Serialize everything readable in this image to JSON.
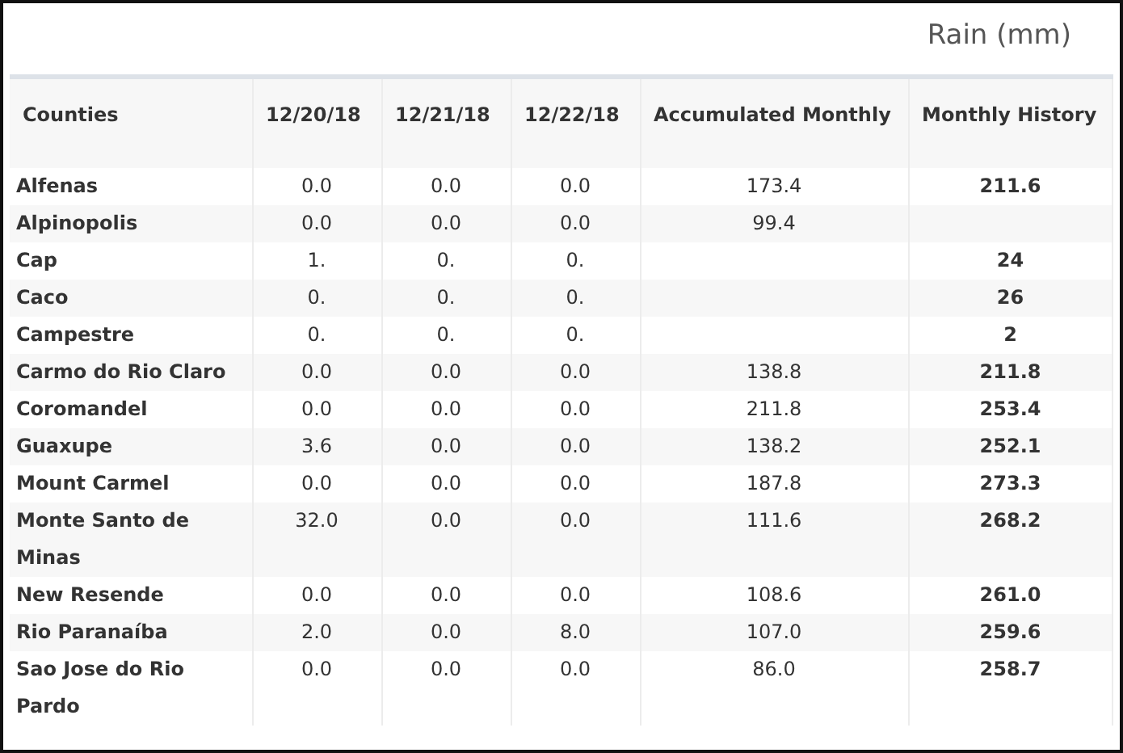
{
  "title": "Rain (mm)",
  "table": {
    "columns": [
      "Counties",
      "12/20/18",
      "12/21/18",
      "12/22/18",
      "Accumulated Monthly",
      "Monthly History"
    ],
    "rows": [
      [
        "Alfenas",
        "0.0",
        "0.0",
        "0.0",
        "173.4",
        "211.6"
      ],
      [
        "Alpinopolis",
        "0.0",
        "0.0",
        "0.0",
        "99.4",
        null
      ],
      [
        "Cap",
        "1.",
        "0.",
        "0.",
        null,
        "24"
      ],
      [
        "Caco",
        "0.",
        "0.",
        "0.",
        null,
        "26"
      ],
      [
        "Campestre",
        "0.",
        "0.",
        "0.",
        null,
        "2"
      ],
      [
        "Carmo do Rio Claro",
        "0.0",
        "0.0",
        "0.0",
        "138.8",
        "211.8"
      ],
      [
        "Coromandel",
        "0.0",
        "0.0",
        "0.0",
        "211.8",
        "253.4"
      ],
      [
        "Guaxupe",
        "3.6",
        "0.0",
        "0.0",
        "138.2",
        "252.1"
      ],
      [
        "Mount Carmel",
        "0.0",
        "0.0",
        "0.0",
        "187.8",
        "273.3"
      ],
      [
        "Monte Santo de Minas",
        "32.0",
        "0.0",
        "0.0",
        "111.6",
        "268.2"
      ],
      [
        "New Resende",
        "0.0",
        "0.0",
        "0.0",
        "108.6",
        "261.0"
      ],
      [
        "Rio Paranaíba",
        "2.0",
        "0.0",
        "8.0",
        "107.0",
        "259.6"
      ],
      [
        "Sao Jose do Rio Pardo",
        "0.0",
        "0.0",
        "0.0",
        "86.0",
        "258.7"
      ]
    ]
  }
}
